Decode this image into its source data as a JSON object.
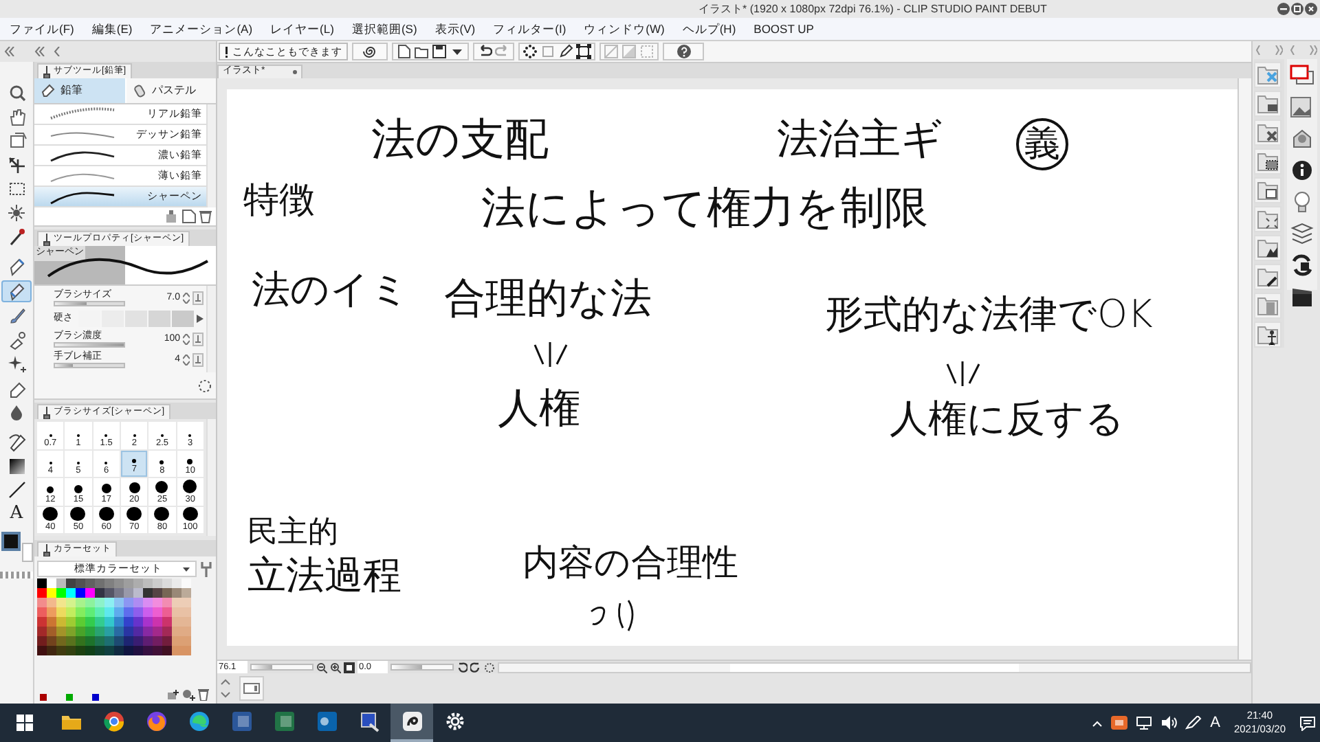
{
  "title_bar": {
    "title": "イラスト* (1920 x 1080px 72dpi 76.1%) - CLIP STUDIO PAINT DEBUT"
  },
  "menu": [
    "ファイル(F)",
    "編集(E)",
    "アニメーション(A)",
    "レイヤー(L)",
    "選択範囲(S)",
    "表示(V)",
    "フィルター(I)",
    "ウィンドウ(W)",
    "ヘルプ(H)",
    "BOOST UP"
  ],
  "toolbar": {
    "tip_button": "こんなこともできます"
  },
  "document_tab": {
    "label": "イラスト*"
  },
  "tools": [
    {
      "kind": "zoom",
      "selected": false
    },
    {
      "kind": "hand",
      "selected": false
    },
    {
      "kind": "view",
      "selected": false
    },
    {
      "kind": "move",
      "selected": false
    },
    {
      "kind": "marquee",
      "selected": false
    },
    {
      "kind": "wand",
      "selected": false
    },
    {
      "kind": "dropper",
      "selected": false
    },
    {
      "kind": "pen",
      "selected": false
    },
    {
      "kind": "pencil",
      "selected": true
    },
    {
      "kind": "brush",
      "selected": false
    },
    {
      "kind": "airbrush",
      "selected": false
    },
    {
      "kind": "sparkle",
      "selected": false
    },
    {
      "kind": "eraser",
      "selected": false
    },
    {
      "kind": "fill",
      "selected": false
    },
    {
      "kind": "bucket",
      "selected": false
    },
    {
      "kind": "gradient",
      "selected": false
    },
    {
      "kind": "line",
      "selected": false
    },
    {
      "kind": "text",
      "glyph": "A",
      "selected": false
    }
  ],
  "sub_tool": {
    "title": "サブツール[鉛筆]",
    "tabs": [
      {
        "label": "鉛筆",
        "selected": true
      },
      {
        "label": "パステル",
        "selected": false
      }
    ],
    "items": [
      {
        "label": "リアル鉛筆",
        "selected": false
      },
      {
        "label": "デッサン鉛筆",
        "selected": false
      },
      {
        "label": "濃い鉛筆",
        "selected": false
      },
      {
        "label": "薄い鉛筆",
        "selected": false
      },
      {
        "label": "シャーペン",
        "selected": true
      }
    ]
  },
  "tool_property": {
    "title": "ツールプロパティ[シャーペン]",
    "preview_label": "シャーペン",
    "properties": [
      {
        "kind": "spin",
        "label": "ブラシサイズ",
        "value": "7.0",
        "level": 0.45
      },
      {
        "kind": "segments",
        "label": "硬さ"
      },
      {
        "kind": "spin",
        "label": "ブラシ濃度",
        "value": "100",
        "level": 1
      },
      {
        "kind": "spin",
        "label": "手ブレ補正",
        "value": "4",
        "level": 0.25
      }
    ]
  },
  "brush_size": {
    "title": "ブラシサイズ[シャーペン]",
    "sizes": [
      {
        "label": "0.7",
        "selected": false
      },
      {
        "label": "1",
        "selected": false
      },
      {
        "label": "1.5",
        "selected": false
      },
      {
        "label": "2",
        "selected": false
      },
      {
        "label": "2.5",
        "selected": false
      },
      {
        "label": "3",
        "selected": false
      },
      {
        "label": "4",
        "selected": false
      },
      {
        "label": "5",
        "selected": false
      },
      {
        "label": "6",
        "selected": false
      },
      {
        "label": "7",
        "selected": true
      },
      {
        "label": "8",
        "selected": false
      },
      {
        "label": "10",
        "selected": false
      },
      {
        "label": "12",
        "selected": false
      },
      {
        "label": "15",
        "selected": false
      },
      {
        "label": "17",
        "selected": false
      },
      {
        "label": "20",
        "selected": false
      },
      {
        "label": "25",
        "selected": false
      },
      {
        "label": "30",
        "selected": false
      },
      {
        "label": "40",
        "selected": false
      },
      {
        "label": "50",
        "selected": false
      },
      {
        "label": "60",
        "selected": false
      },
      {
        "label": "70",
        "selected": false
      },
      {
        "label": "80",
        "selected": false
      },
      {
        "label": "100",
        "selected": false
      }
    ]
  },
  "color_set": {
    "title": "カラーセット",
    "set_name": "標準カラーセット"
  },
  "canvas": {
    "writings": [
      {
        "text": "法の支配",
        "circled": false
      },
      {
        "text": "法治主ギ",
        "circled": false
      },
      {
        "text": "義",
        "circled": true
      },
      {
        "text": "特徴",
        "circled": false
      },
      {
        "text": "法によって権力を制限",
        "circled": false
      },
      {
        "text": "法のイミ",
        "circled": false
      },
      {
        "text": "合理的な法",
        "circled": false
      },
      {
        "text": "形式的な法律でOK",
        "circled": false
      },
      {
        "text": "人権",
        "circled": false
      },
      {
        "text": "人権に反する",
        "circled": false
      },
      {
        "text": "民主的",
        "circled": false
      },
      {
        "text": "立法過程",
        "circled": false
      },
      {
        "text": "内容の合理性",
        "circled": false
      }
    ]
  },
  "status_bar": {
    "zoom": "76.1",
    "zoom_slider": {
      "level": 0.35
    },
    "angle": "0.0",
    "angle_slider": {
      "level": 0.5
    }
  },
  "taskbar": {
    "apps": [
      {
        "kind": "folder",
        "selected": false
      },
      {
        "kind": "browser1",
        "selected": false
      },
      {
        "kind": "browser2",
        "selected": false
      },
      {
        "kind": "browser3",
        "selected": false
      },
      {
        "kind": "doc",
        "selected": false
      },
      {
        "kind": "sheet",
        "selected": false
      },
      {
        "kind": "mail",
        "selected": false
      },
      {
        "kind": "tool",
        "selected": false
      },
      {
        "kind": "paint",
        "selected": true
      },
      {
        "kind": "settings",
        "selected": false
      }
    ],
    "ime": "A",
    "time": "21:40",
    "date": "2021/03/20"
  }
}
